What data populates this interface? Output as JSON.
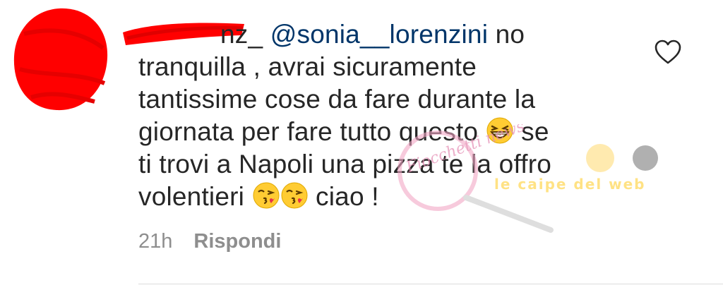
{
  "comment": {
    "username_visible_suffix": "nz_",
    "mention": "@sonia__lorenzini",
    "lines": [
      " no",
      "tranquilla , avrai sicuramente",
      "tantissime cose da fare durante la",
      "giornata per fare tutto questo ",
      " se",
      "ti trovi a Napoli una pizza te la offro",
      "volentieri ",
      " ciao !"
    ],
    "timestamp": "21h",
    "reply_label": "Rispondi"
  },
  "watermark": {
    "text": "le caipe del web",
    "script_text": "Fiocchetti news"
  },
  "colors": {
    "text": "#262626",
    "mention": "#003569",
    "meta": "#8e8e8e",
    "redaction": "#ff0000",
    "divider": "#dbdbdb"
  },
  "icons": {
    "like": "heart-outline-icon",
    "emoji_laugh": "grinning-squinting-face-emoji",
    "emoji_kiss": "face-blowing-kiss-emoji"
  }
}
